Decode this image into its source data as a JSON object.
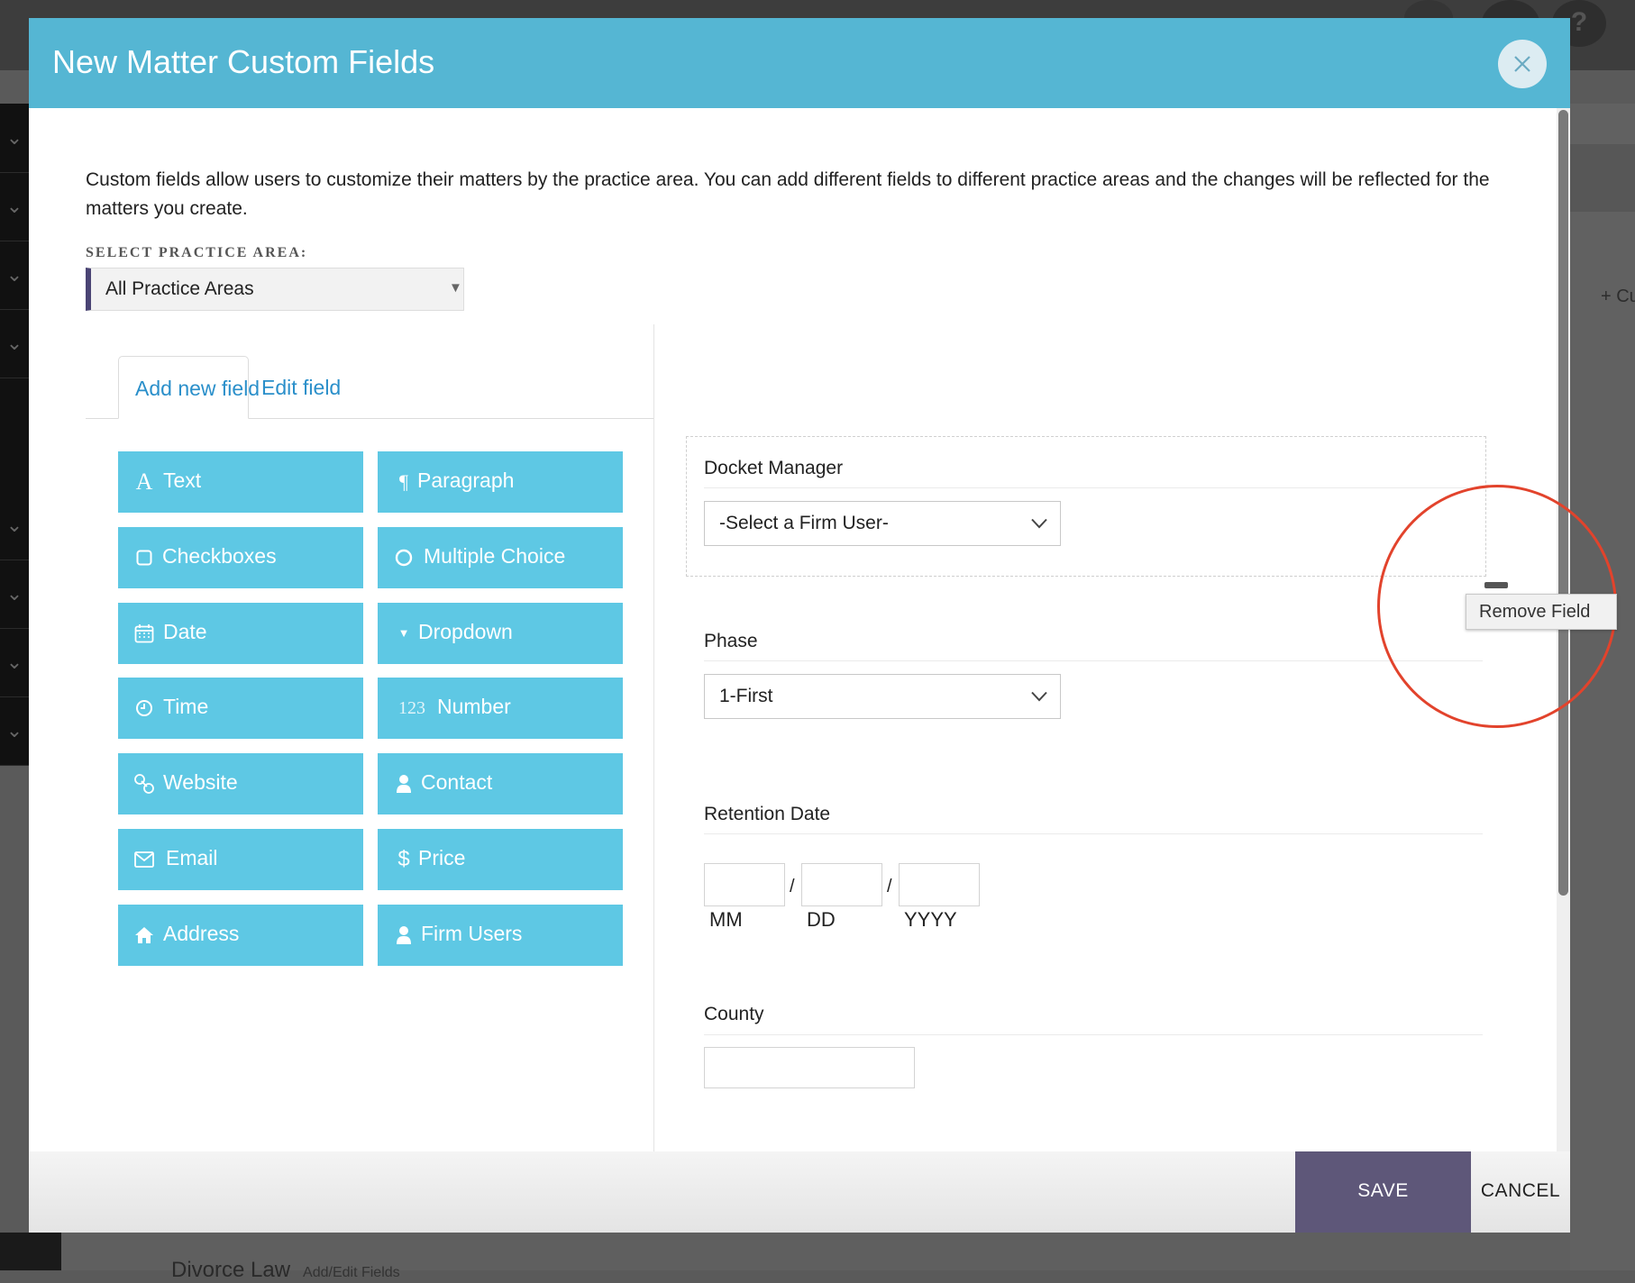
{
  "modal": {
    "title": "New Matter Custom Fields",
    "intro": "Custom fields allow users to customize their matters by the practice area. You can add different fields to different practice areas and the changes will be reflected for the matters you create.",
    "practice_area_label": "SELECT PRACTICE AREA:",
    "practice_area_value": "All Practice Areas"
  },
  "tabs": [
    {
      "label": "Add new field",
      "active": true
    },
    {
      "label": "Edit field",
      "active": false
    }
  ],
  "field_types": [
    {
      "label": "Text",
      "icon": "letter-a-icon"
    },
    {
      "label": "Paragraph",
      "icon": "pilcrow-icon"
    },
    {
      "label": "Checkboxes",
      "icon": "checkbox-icon"
    },
    {
      "label": "Multiple Choice",
      "icon": "radio-icon"
    },
    {
      "label": "Date",
      "icon": "calendar-icon"
    },
    {
      "label": "Dropdown",
      "icon": "caret-down-icon"
    },
    {
      "label": "Time",
      "icon": "clock-icon"
    },
    {
      "label": "Number",
      "icon": "numbers-icon",
      "icon_text": "123"
    },
    {
      "label": "Website",
      "icon": "link-icon"
    },
    {
      "label": "Contact",
      "icon": "person-icon"
    },
    {
      "label": "Email",
      "icon": "envelope-icon"
    },
    {
      "label": "Price",
      "icon": "dollar-icon"
    },
    {
      "label": "Address",
      "icon": "home-icon"
    },
    {
      "label": "Firm Users",
      "icon": "person-icon"
    }
  ],
  "fields": {
    "docket_manager": {
      "label": "Docket Manager",
      "value": "-Select a Firm User-"
    },
    "phase": {
      "label": "Phase",
      "value": "1-First"
    },
    "retention_date": {
      "label": "Retention Date",
      "separator": "/",
      "mm": "MM",
      "dd": "DD",
      "yyyy": "YYYY"
    },
    "county": {
      "label": "County",
      "value": ""
    }
  },
  "tooltip": {
    "remove_field": "Remove Field"
  },
  "footer": {
    "save": "SAVE",
    "cancel": "CANCEL"
  },
  "background": {
    "add_label": "+ Cu",
    "bottom_title": "Divorce Law",
    "bottom_link": "Add/Edit Fields",
    "help_glyph": "?"
  },
  "colors": {
    "header": "#55b6d3",
    "field_button": "#5ec8e4",
    "save_button": "#5e5779",
    "tab_text": "#2a8fca",
    "highlight": "#e2432c"
  }
}
